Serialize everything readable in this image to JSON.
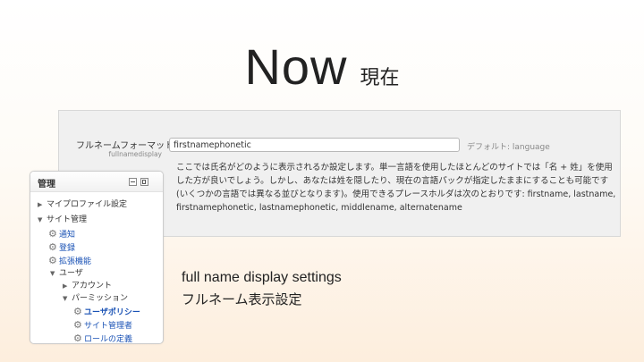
{
  "slide": {
    "title": "Now",
    "title_sub": "現在",
    "caption_en": "full name display settings",
    "caption_ja": "フルネーム表示設定"
  },
  "setting": {
    "label": "フルネームフォーマット",
    "key": "fullnamedisplay",
    "value": "firstnamephonetic",
    "default_text": "デフォルト: language",
    "description": "ここでは氏名がどのように表示されるか設定します。単一言語を使用したほとんどのサイトでは「名 + 姓」を使用した方が良いでしょう。しかし、あなたは姓を隠したり、現在の言語パックが指定したままにすることも可能です (いくつかの言語では異なる並びとなります)。使用できるプレースホルダは次のとおりです: firstname, lastname, firstnamephonetic, lastnamephonetic, middlename, alternatename"
  },
  "admin": {
    "title": "管理",
    "items": [
      {
        "label": "マイプロファイル設定",
        "icon": "arrow-right",
        "link": false
      },
      {
        "label": "サイト管理",
        "icon": "arrow-down",
        "link": false
      },
      {
        "label": "通知",
        "icon": "gear-icon",
        "link": true
      },
      {
        "label": "登録",
        "icon": "gear-icon",
        "link": true
      },
      {
        "label": "拡張機能",
        "icon": "gear-icon",
        "link": true
      },
      {
        "label": "ユーザ",
        "icon": "arrow-down",
        "link": false
      },
      {
        "label": "アカウント",
        "icon": "arrow-right",
        "link": false
      },
      {
        "label": "パーミッション",
        "icon": "arrow-down",
        "link": false
      },
      {
        "label": "ユーザポリシー",
        "icon": "gear-icon",
        "link": true
      },
      {
        "label": "サイト管理者",
        "icon": "gear-icon",
        "link": true
      },
      {
        "label": "ロールの定義",
        "icon": "gear-icon",
        "link": true
      }
    ]
  }
}
